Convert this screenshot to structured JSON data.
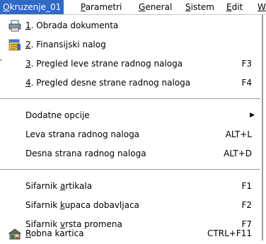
{
  "menubar": {
    "items": [
      {
        "pre": "",
        "ul": "O",
        "post": "kruzenje_01",
        "active": true
      },
      {
        "pre": "",
        "ul": "P",
        "post": "arametri",
        "active": false
      },
      {
        "pre": "",
        "ul": "G",
        "post": "eneral",
        "active": false
      },
      {
        "pre": "",
        "ul": "S",
        "post": "istem",
        "active": false
      },
      {
        "pre": "",
        "ul": "E",
        "post": "dit",
        "active": false
      },
      {
        "pre": "",
        "ul": "W",
        "post": "",
        "active": false
      }
    ]
  },
  "menu": {
    "tick": ",",
    "items": [
      {
        "pre": "",
        "ul": "1",
        "post": ". Obrada dokumenta",
        "shortcut": "",
        "icon": "printer-icon"
      },
      {
        "pre": "",
        "ul": "2",
        "post": ". Finansijski nalog",
        "shortcut": "",
        "icon": "ledger-icon"
      },
      {
        "pre": "",
        "ul": "3",
        "post": ". Pregled leve strane radnog naloga",
        "shortcut": "F3",
        "icon": ""
      },
      {
        "pre": "",
        "ul": "4",
        "post": ". Pregled desne strane radnog naloga",
        "shortcut": "F4",
        "icon": ""
      },
      {
        "pre": "Dodatne opcije",
        "ul": "",
        "post": "",
        "shortcut": "",
        "icon": "",
        "submenu_arrow": "▶"
      },
      {
        "pre": "Leva strana radnog naloga",
        "ul": "",
        "post": "",
        "shortcut": "ALT+L",
        "icon": ""
      },
      {
        "pre": "Desna strana radnog naloga",
        "ul": "",
        "post": "",
        "shortcut": "ALT+D",
        "icon": ""
      },
      {
        "pre": "Sifarnik ",
        "ul": "a",
        "post": "rtikala",
        "shortcut": "F1",
        "icon": ""
      },
      {
        "pre": "Sifarnik ",
        "ul": "k",
        "post": "upaca dobavljaca",
        "shortcut": "F2",
        "icon": ""
      },
      {
        "pre": "Sifarnik ",
        "ul": "v",
        "post": "rsta promena",
        "shortcut": "F7",
        "icon": ""
      },
      {
        "pre": "",
        "ul": "R",
        "post": "obna kartica",
        "shortcut": "CTRL+F11",
        "icon": "warehouse-icon"
      }
    ]
  },
  "colors": {
    "highlight": "#316ac5",
    "separator": "#9d9d9d"
  }
}
